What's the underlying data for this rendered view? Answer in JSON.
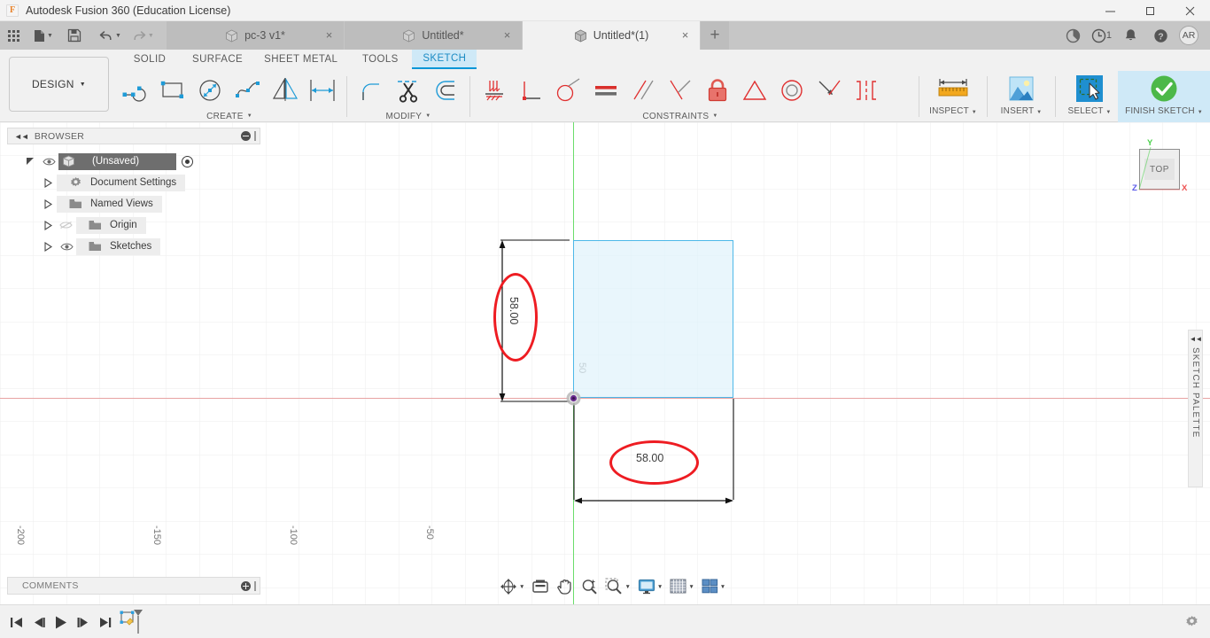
{
  "window": {
    "title": "Autodesk Fusion 360 (Education License)",
    "logo_letter": "F",
    "minimize": "minimize-icon",
    "maximize": "maximize-icon",
    "close": "close-icon"
  },
  "quick_access": {
    "app_grid": "app-grid-icon",
    "new": "new-file-icon",
    "save": "save-icon",
    "undo": "undo-icon",
    "redo": "redo-icon",
    "caret": "▼"
  },
  "document_tabs": [
    {
      "label": "pc-3 v1*",
      "active": false,
      "close": "×"
    },
    {
      "label": "Untitled*",
      "active": false,
      "close": "×"
    },
    {
      "label": "Untitled*(1)",
      "active": true,
      "close": "×"
    }
  ],
  "tab_add": "+",
  "account": {
    "extension_icon": "extension-icon",
    "job_status_icon": "job-status-icon",
    "job_count": "1",
    "notifications_icon": "bell-icon",
    "help_icon": "help-icon",
    "avatar_initials": "AR"
  },
  "ribbon": {
    "workspace_label": "DESIGN",
    "workspace_caret": "▼",
    "tabs": [
      {
        "label": "SOLID",
        "active": false
      },
      {
        "label": "SURFACE",
        "active": false
      },
      {
        "label": "SHEET METAL",
        "active": false
      },
      {
        "label": "TOOLS",
        "active": false
      },
      {
        "label": "SKETCH",
        "active": true
      }
    ],
    "panels": [
      {
        "label": "CREATE",
        "caret": "▼",
        "tools": [
          "line-icon",
          "rectangle-icon",
          "circle-icon",
          "spline-icon",
          "mirror-icon",
          "offset-dimension-icon"
        ]
      },
      {
        "label": "MODIFY",
        "caret": "▼",
        "tools": [
          "fillet-icon",
          "trim-scissors-icon",
          "offset-icon"
        ]
      },
      {
        "label": "CONSTRAINTS",
        "caret": "▼",
        "tools": [
          "fix-ground-icon",
          "horizontal-vertical-icon",
          "tangent-icon",
          "equal-icon",
          "parallel-icon",
          "perpendicular-icon",
          "lock-dimension-icon",
          "midpoint-icon",
          "concentric-icon",
          "collinear-icon",
          "symmetry-icon"
        ]
      }
    ],
    "right_buttons": [
      {
        "label": "INSPECT",
        "caret": "▼",
        "icon": "ruler-icon"
      },
      {
        "label": "INSERT",
        "caret": "▼",
        "icon": "image-insert-icon"
      },
      {
        "label": "SELECT",
        "caret": "▼",
        "icon": "select-cursor-icon"
      },
      {
        "label": "FINISH SKETCH",
        "caret": "▼",
        "icon": "green-check-icon"
      }
    ]
  },
  "browser": {
    "title": "BROWSER",
    "collapse_icon": "◄◄",
    "minus_icon": "collapse-dot-icon",
    "grip_icon": "panel-grip-icon",
    "tree": [
      {
        "label": "(Unsaved)",
        "indent": 0,
        "arrow": "expand-arrow-down",
        "eye": "eye-visible-icon",
        "icon": "document-cube-icon",
        "root": true,
        "radio": true
      },
      {
        "label": "Document Settings",
        "indent": 1,
        "arrow": "expand-arrow-right",
        "eye": "",
        "icon": "gear-icon",
        "root": false,
        "radio": false
      },
      {
        "label": "Named Views",
        "indent": 1,
        "arrow": "expand-arrow-right",
        "eye": "",
        "icon": "folder-icon",
        "root": false,
        "radio": false
      },
      {
        "label": "Origin",
        "indent": 1,
        "arrow": "expand-arrow-right",
        "eye": "eye-hidden-icon",
        "icon": "folder-icon",
        "root": false,
        "radio": false
      },
      {
        "label": "Sketches",
        "indent": 1,
        "arrow": "expand-arrow-right",
        "eye": "eye-visible-icon",
        "icon": "folder-icon",
        "root": false,
        "radio": false
      }
    ]
  },
  "comments": {
    "title": "COMMENTS",
    "add_icon": "add-comment-icon",
    "grip_icon": "panel-grip-icon"
  },
  "canvas": {
    "ruler_labels": [
      "-200",
      "-150",
      "-100",
      "-50"
    ],
    "y_label": "50",
    "dimension_vertical": "58.00",
    "dimension_horizontal": "58.00",
    "origin_icon": "sketch-origin-point",
    "annotation_color": "#ee1c22",
    "sketch_edge_color": "#4db8e8",
    "sketch_fill_color": "#e1f2fb",
    "x_axis_color": "#e8a2a2",
    "y_axis_color": "#6bdd6b"
  },
  "viewcube": {
    "face_label": "TOP",
    "axis_x": "X",
    "axis_y": "Y",
    "axis_z": "Z"
  },
  "sketch_palette": {
    "label": "SKETCH PALETTE",
    "collapse_icon": "◄◄"
  },
  "navbar": {
    "items": [
      {
        "icon": "orbit-icon",
        "caret": "▼"
      },
      {
        "icon": "look-at-icon",
        "caret": ""
      },
      {
        "icon": "pan-hand-icon",
        "caret": ""
      },
      {
        "icon": "zoom-icon",
        "caret": ""
      },
      {
        "icon": "fit-icon",
        "caret": "▼"
      },
      {
        "icon": "display-settings-icon",
        "caret": "▼"
      },
      {
        "icon": "grid-snaps-icon",
        "caret": "▼"
      },
      {
        "icon": "viewport-layout-icon",
        "caret": "▼"
      }
    ]
  },
  "timeline": {
    "buttons": [
      "skip-to-start-icon",
      "step-back-icon",
      "play-icon",
      "step-forward-icon",
      "skip-to-end-icon"
    ],
    "feature_icon": "sketch-feature-icon",
    "settings_icon": "gear-icon"
  }
}
